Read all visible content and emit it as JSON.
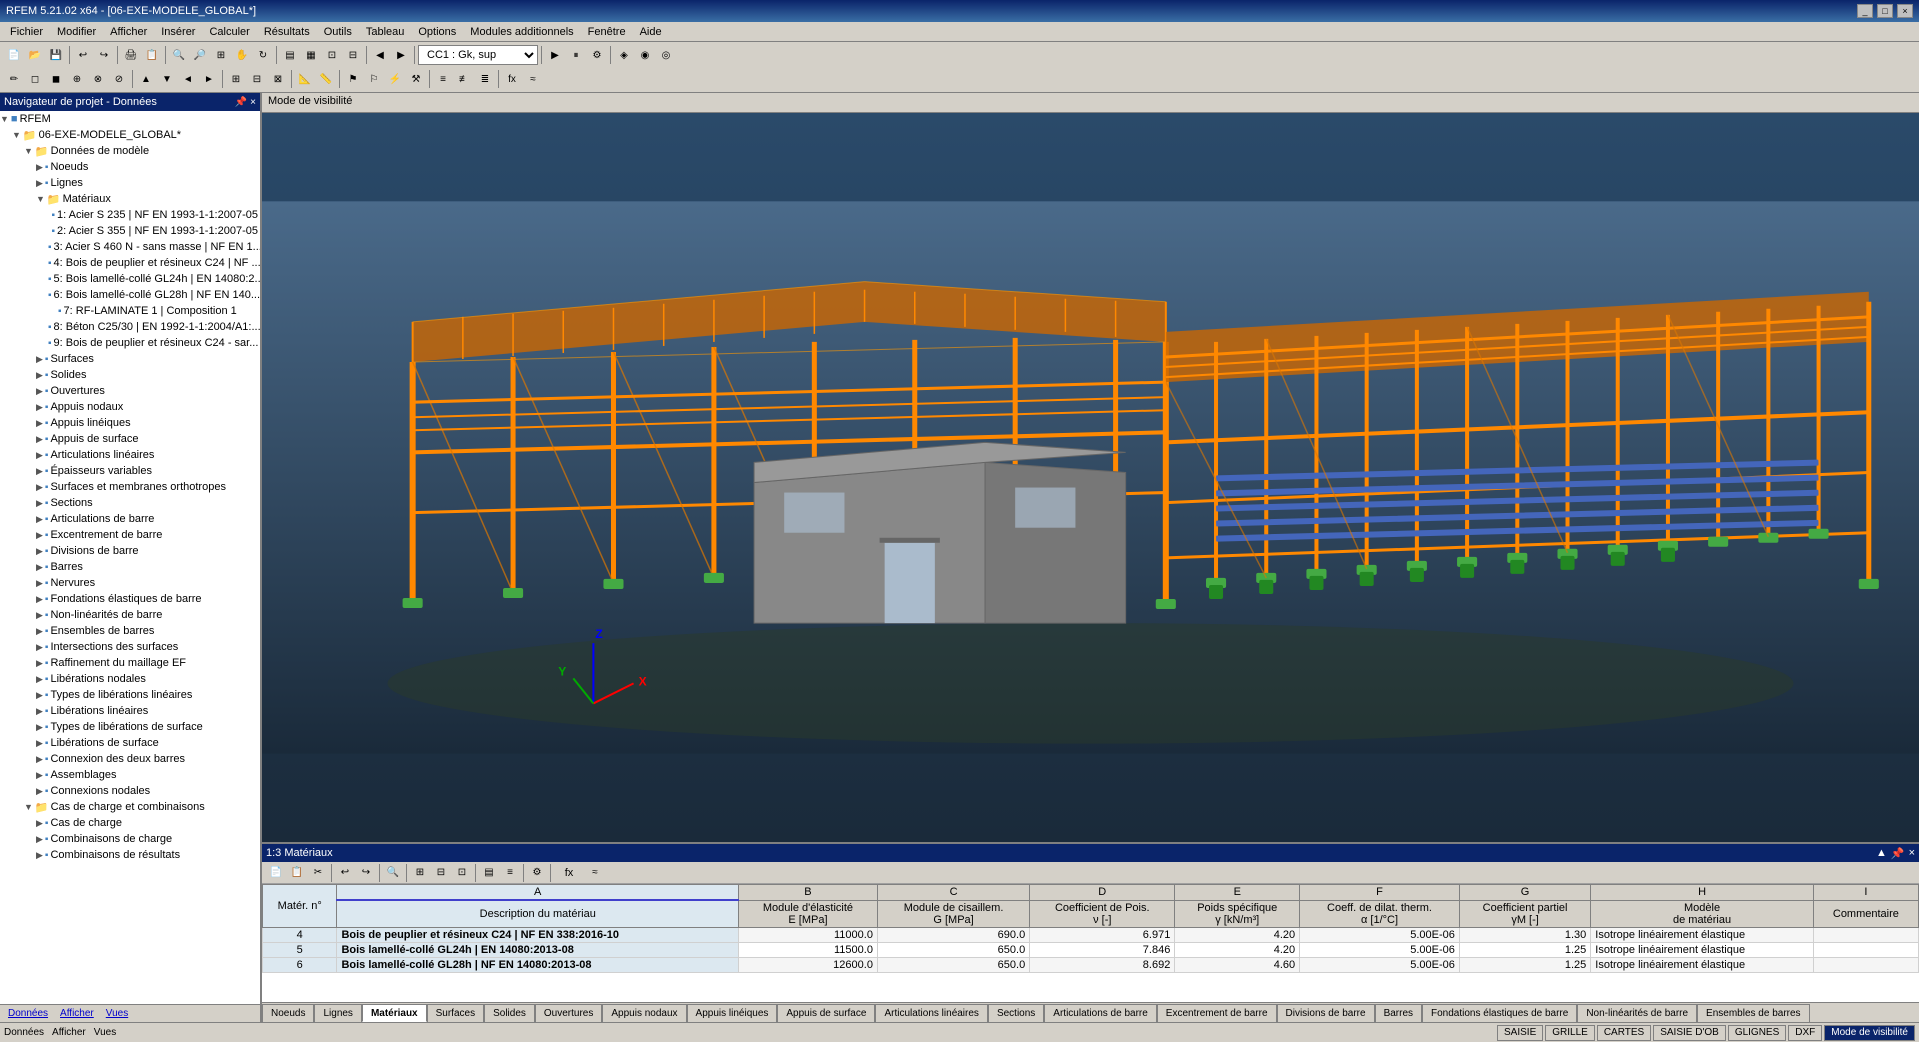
{
  "title_bar": {
    "text": "RFEM 5.21.02 x64 - [06-EXE-MODELE_GLOBAL*]",
    "buttons": [
      "_",
      "□",
      "×"
    ]
  },
  "menu": {
    "items": [
      "Fichier",
      "Modifier",
      "Afficher",
      "Insérer",
      "Calculer",
      "Résultats",
      "Outils",
      "Tableau",
      "Options",
      "Modules additionnels",
      "Fenêtre",
      "Aide"
    ]
  },
  "toolbar": {
    "combo_value": "CC1 : Gk, sup"
  },
  "left_panel": {
    "title": "Navigateur de projet - Données",
    "tree": [
      {
        "label": "RFEM",
        "indent": 0,
        "type": "root",
        "expand": "▼"
      },
      {
        "label": "06-EXE-MODELE_GLOBAL*",
        "indent": 1,
        "type": "folder",
        "expand": "▼"
      },
      {
        "label": "Données de modèle",
        "indent": 2,
        "type": "folder",
        "expand": "▼"
      },
      {
        "label": "Noeuds",
        "indent": 3,
        "type": "item",
        "expand": "▶"
      },
      {
        "label": "Lignes",
        "indent": 3,
        "type": "item",
        "expand": "▶"
      },
      {
        "label": "Matériaux",
        "indent": 3,
        "type": "folder",
        "expand": "▼"
      },
      {
        "label": "1: Acier S 235 | NF EN 1993-1-1:2007-05",
        "indent": 4,
        "type": "item",
        "expand": ""
      },
      {
        "label": "2: Acier S 355 | NF EN 1993-1-1:2007-05",
        "indent": 4,
        "type": "item",
        "expand": ""
      },
      {
        "label": "3: Acier S 460 N - sans masse | NF EN 1...",
        "indent": 4,
        "type": "item",
        "expand": ""
      },
      {
        "label": "4: Bois de peuplier et résineux C24 | NF ...",
        "indent": 4,
        "type": "item",
        "expand": ""
      },
      {
        "label": "5: Bois lamellé-collé GL24h | EN 14080:2...",
        "indent": 4,
        "type": "item",
        "expand": ""
      },
      {
        "label": "6: Bois lamellé-collé GL28h | NF EN 140...",
        "indent": 4,
        "type": "item",
        "expand": ""
      },
      {
        "label": "7: RF-LAMINATE 1 | Composition 1",
        "indent": 4,
        "type": "item",
        "expand": ""
      },
      {
        "label": "8: Béton C25/30 | EN 1992-1-1:2004/A1:...",
        "indent": 4,
        "type": "item",
        "expand": ""
      },
      {
        "label": "9: Bois de peuplier et résineux C24 - sar...",
        "indent": 4,
        "type": "item",
        "expand": ""
      },
      {
        "label": "Surfaces",
        "indent": 3,
        "type": "item",
        "expand": "▶"
      },
      {
        "label": "Solides",
        "indent": 3,
        "type": "item",
        "expand": "▶"
      },
      {
        "label": "Ouvertures",
        "indent": 3,
        "type": "item",
        "expand": "▶"
      },
      {
        "label": "Appuis nodaux",
        "indent": 3,
        "type": "item",
        "expand": "▶"
      },
      {
        "label": "Appuis linéiques",
        "indent": 3,
        "type": "item",
        "expand": "▶"
      },
      {
        "label": "Appuis de surface",
        "indent": 3,
        "type": "item",
        "expand": "▶"
      },
      {
        "label": "Articulations linéaires",
        "indent": 3,
        "type": "item",
        "expand": "▶"
      },
      {
        "label": "Épaisseurs variables",
        "indent": 3,
        "type": "item",
        "expand": "▶"
      },
      {
        "label": "Surfaces et membranes orthotropes",
        "indent": 3,
        "type": "item",
        "expand": "▶"
      },
      {
        "label": "Sections",
        "indent": 3,
        "type": "item",
        "expand": "▶"
      },
      {
        "label": "Articulations de barre",
        "indent": 3,
        "type": "item",
        "expand": "▶"
      },
      {
        "label": "Excentrement de barre",
        "indent": 3,
        "type": "item",
        "expand": "▶"
      },
      {
        "label": "Divisions de barre",
        "indent": 3,
        "type": "item",
        "expand": "▶"
      },
      {
        "label": "Barres",
        "indent": 3,
        "type": "item",
        "expand": "▶"
      },
      {
        "label": "Nervures",
        "indent": 3,
        "type": "item",
        "expand": "▶"
      },
      {
        "label": "Fondations élastiques de barre",
        "indent": 3,
        "type": "item",
        "expand": "▶"
      },
      {
        "label": "Non-linéarités de barre",
        "indent": 3,
        "type": "item",
        "expand": "▶"
      },
      {
        "label": "Ensembles de barres",
        "indent": 3,
        "type": "item",
        "expand": "▶"
      },
      {
        "label": "Intersections des surfaces",
        "indent": 3,
        "type": "item",
        "expand": "▶"
      },
      {
        "label": "Raffinement du maillage EF",
        "indent": 3,
        "type": "item",
        "expand": "▶"
      },
      {
        "label": "Libérations nodales",
        "indent": 3,
        "type": "item",
        "expand": "▶"
      },
      {
        "label": "Types de libérations linéaires",
        "indent": 3,
        "type": "item",
        "expand": "▶"
      },
      {
        "label": "Libérations linéaires",
        "indent": 3,
        "type": "item",
        "expand": "▶"
      },
      {
        "label": "Types de libérations de surface",
        "indent": 3,
        "type": "item",
        "expand": "▶"
      },
      {
        "label": "Libérations de surface",
        "indent": 3,
        "type": "item",
        "expand": "▶"
      },
      {
        "label": "Connexion des deux barres",
        "indent": 3,
        "type": "item",
        "expand": "▶"
      },
      {
        "label": "Assemblages",
        "indent": 3,
        "type": "item",
        "expand": "▶"
      },
      {
        "label": "Connexions nodales",
        "indent": 3,
        "type": "item",
        "expand": "▶"
      },
      {
        "label": "Cas de charge et combinaisons",
        "indent": 2,
        "type": "folder",
        "expand": "▼"
      },
      {
        "label": "Cas de charge",
        "indent": 3,
        "type": "item",
        "expand": "▶"
      },
      {
        "label": "Combinaisons de charge",
        "indent": 3,
        "type": "item",
        "expand": "▶"
      },
      {
        "label": "Combinaisons de résultats",
        "indent": 3,
        "type": "item",
        "expand": "▶"
      }
    ],
    "bottom_tabs": [
      "Données",
      "Afficher",
      "Vues"
    ]
  },
  "viewport": {
    "mode_label": "Mode de visibilité",
    "axis": {
      "x": "X",
      "y": "Y",
      "z": "Z"
    }
  },
  "data_panel": {
    "title": "1:3 Matériaux",
    "columns": [
      {
        "id": "A",
        "label": "A"
      },
      {
        "id": "B",
        "label": "B"
      },
      {
        "id": "C",
        "label": "C"
      },
      {
        "id": "D",
        "label": "D"
      },
      {
        "id": "E",
        "label": "E"
      },
      {
        "id": "F",
        "label": "F"
      },
      {
        "id": "G",
        "label": "G"
      },
      {
        "id": "H",
        "label": "H"
      },
      {
        "id": "I",
        "label": "I"
      }
    ],
    "col_headers": [
      "Matér. n°",
      "Description du matériau",
      "Module d'élasticité E [MPa]",
      "Module de cisaillement G [MPa]",
      "Coefficient de Poisson ν [-]",
      "Poids spécifique γ [kN/m³]",
      "Coeff. de dilat. therm. α [1/°C]",
      "Coefficient partiel γM [-]",
      "Modèle de matériau",
      "Commentaire"
    ],
    "rows": [
      {
        "num": "4",
        "desc": "Bois de peuplier et résineux C24 | NF EN 338:2016-10",
        "E": "11000.0",
        "G": "690.0",
        "nu": "6.971",
        "gamma": "4.20",
        "alpha": "5.00E-06",
        "gammaM": "1.30",
        "model": "Isotrope linéairement élastique",
        "comment": "",
        "selected": false
      },
      {
        "num": "5",
        "desc": "Bois lamellé-collé GL24h | EN 14080:2013-08",
        "E": "11500.0",
        "G": "650.0",
        "nu": "7.846",
        "gamma": "4.20",
        "alpha": "5.00E-06",
        "gammaM": "1.25",
        "model": "Isotrope linéairement élastique",
        "comment": "",
        "selected": false
      },
      {
        "num": "6",
        "desc": "Bois lamellé-collé GL28h | NF EN 14080:2013-08",
        "E": "12600.0",
        "G": "650.0",
        "nu": "8.692",
        "gamma": "4.60",
        "alpha": "5.00E-06",
        "gammaM": "1.25",
        "model": "Isotrope linéairement élastique",
        "comment": "",
        "selected": false
      }
    ]
  },
  "tab_bar": {
    "tabs": [
      "Noeuds",
      "Lignes",
      "Matériaux",
      "Surfaces",
      "Solides",
      "Ouvertures",
      "Appuis nodaux",
      "Appuis linéiques",
      "Appuis de surface",
      "Articulations linéaires",
      "Sections",
      "Articulations de barre",
      "Excentrement de barre",
      "Divisions de barre",
      "Barres",
      "Fondations élastiques de barre",
      "Non-linéarités de barre",
      "Ensembles de barres"
    ],
    "active": "Matériaux"
  },
  "status_bar": {
    "left": [
      "Données",
      "Afficher",
      "Vues"
    ],
    "right": [
      "SAISIE",
      "GRILLE",
      "CARTES",
      "SAISIE D'OB",
      "GLIGNES",
      "DXF",
      "Mode de visibilité"
    ]
  }
}
